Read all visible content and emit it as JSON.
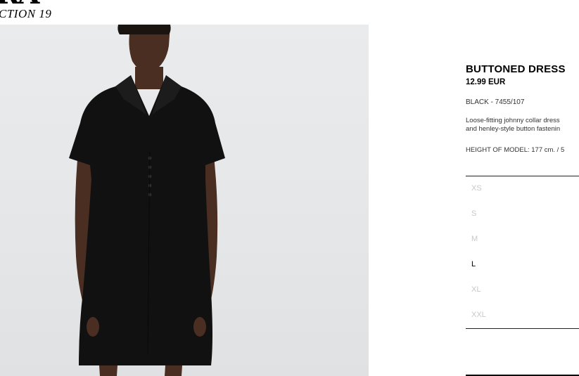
{
  "header": {
    "brand_fragment": "RA",
    "collection": "CTION 19"
  },
  "product": {
    "title": "BUTTONED DRESS",
    "price": "12.99 EUR",
    "color_ref": "BLACK - 7455/107",
    "description_line1": "Loose-fitting johnny collar dress",
    "description_line2": "and henley-style button fastenin",
    "model_height": "HEIGHT OF MODEL: 177 cm. / 5"
  },
  "sizes": [
    {
      "label": "XS",
      "available": false
    },
    {
      "label": "S",
      "available": false
    },
    {
      "label": "M",
      "available": false
    },
    {
      "label": "L",
      "available": true
    },
    {
      "label": "XL",
      "available": false
    },
    {
      "label": "XXL",
      "available": false
    }
  ],
  "colors": {
    "background": "#ffffff",
    "photo_background": "#e6e8ea",
    "dress": "#111111",
    "skin": "#4a2e22",
    "unavailable_size": "#c8c8c8"
  }
}
